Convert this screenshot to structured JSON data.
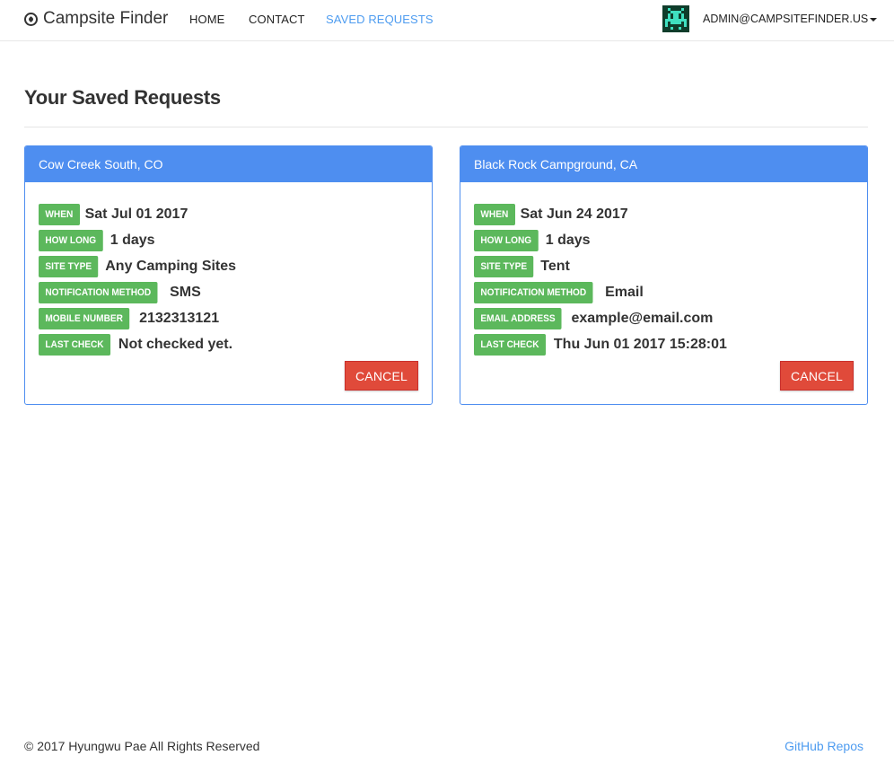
{
  "nav": {
    "brand": "Campsite Finder",
    "links": [
      "HOME",
      "CONTACT",
      "SAVED REQUESTS"
    ],
    "user": "ADMIN@CAMPSITEFINDER.US",
    "accent": "#4e9cf0"
  },
  "page": {
    "title": "Your Saved Requests"
  },
  "cards": [
    {
      "title": "Cow Creek South, CO",
      "rows": [
        {
          "label": "WHEN",
          "value": "Sat Jul 01 2017"
        },
        {
          "label": "HOW LONG",
          "value": "1 days"
        },
        {
          "label": "SITE TYPE",
          "value": "Any Camping Sites"
        },
        {
          "label": "NOTIFICATION METHOD",
          "value": "SMS"
        },
        {
          "label": "MOBILE NUMBER",
          "value": "2132313121"
        },
        {
          "label": "LAST CHECK",
          "value": "Not checked yet."
        }
      ],
      "cancel_label": "CANCEL"
    },
    {
      "title": "Black Rock Campground, CA",
      "rows": [
        {
          "label": "WHEN",
          "value": "Sat Jun 24 2017"
        },
        {
          "label": "HOW LONG",
          "value": "1 days"
        },
        {
          "label": "SITE TYPE",
          "value": "Tent"
        },
        {
          "label": "NOTIFICATION METHOD",
          "value": "Email"
        },
        {
          "label": "EMAIL ADDRESS",
          "value": "example@email.com"
        },
        {
          "label": "LAST CHECK",
          "value": "Thu Jun 01 2017 15:28:01"
        }
      ],
      "cancel_label": "CANCEL"
    }
  ],
  "footer": {
    "copyright": "© 2017 Hyungwu Pae All Rights Reserved",
    "link": "GitHub Repos"
  },
  "colors": {
    "card_header": "#4e8ef0",
    "badge": "#5cb85c",
    "cancel": "#e04a3a"
  }
}
